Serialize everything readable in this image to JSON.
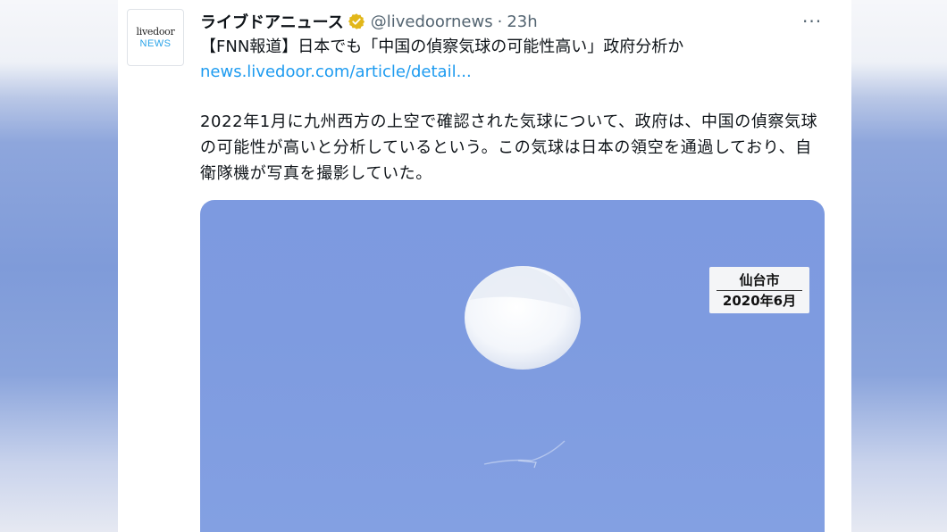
{
  "tweet": {
    "avatar": {
      "line1": "livedoor",
      "line2": "NEWS"
    },
    "display_name": "ライブドアニュース",
    "handle": "@livedoornews",
    "separator": "·",
    "time": "23h",
    "more_label": "···",
    "headline": "【FNN報道】日本でも「中国の偵察気球の可能性高い」政府分析か",
    "link_text": "news.livedoor.com/article/detail...",
    "body": "2022年1月に九州西方の上空で確認された気球について、政府は、中国の偵察気球の可能性が高いと分析しているという。この気球は日本の領空を通過しており、自衛隊機が写真を撮影していた。",
    "media": {
      "caption_place": "仙台市",
      "caption_date": "2020年6月"
    }
  },
  "colors": {
    "link": "#1d9bf0",
    "verified_badge": "#e2b719",
    "sky": "#7e9be0"
  }
}
